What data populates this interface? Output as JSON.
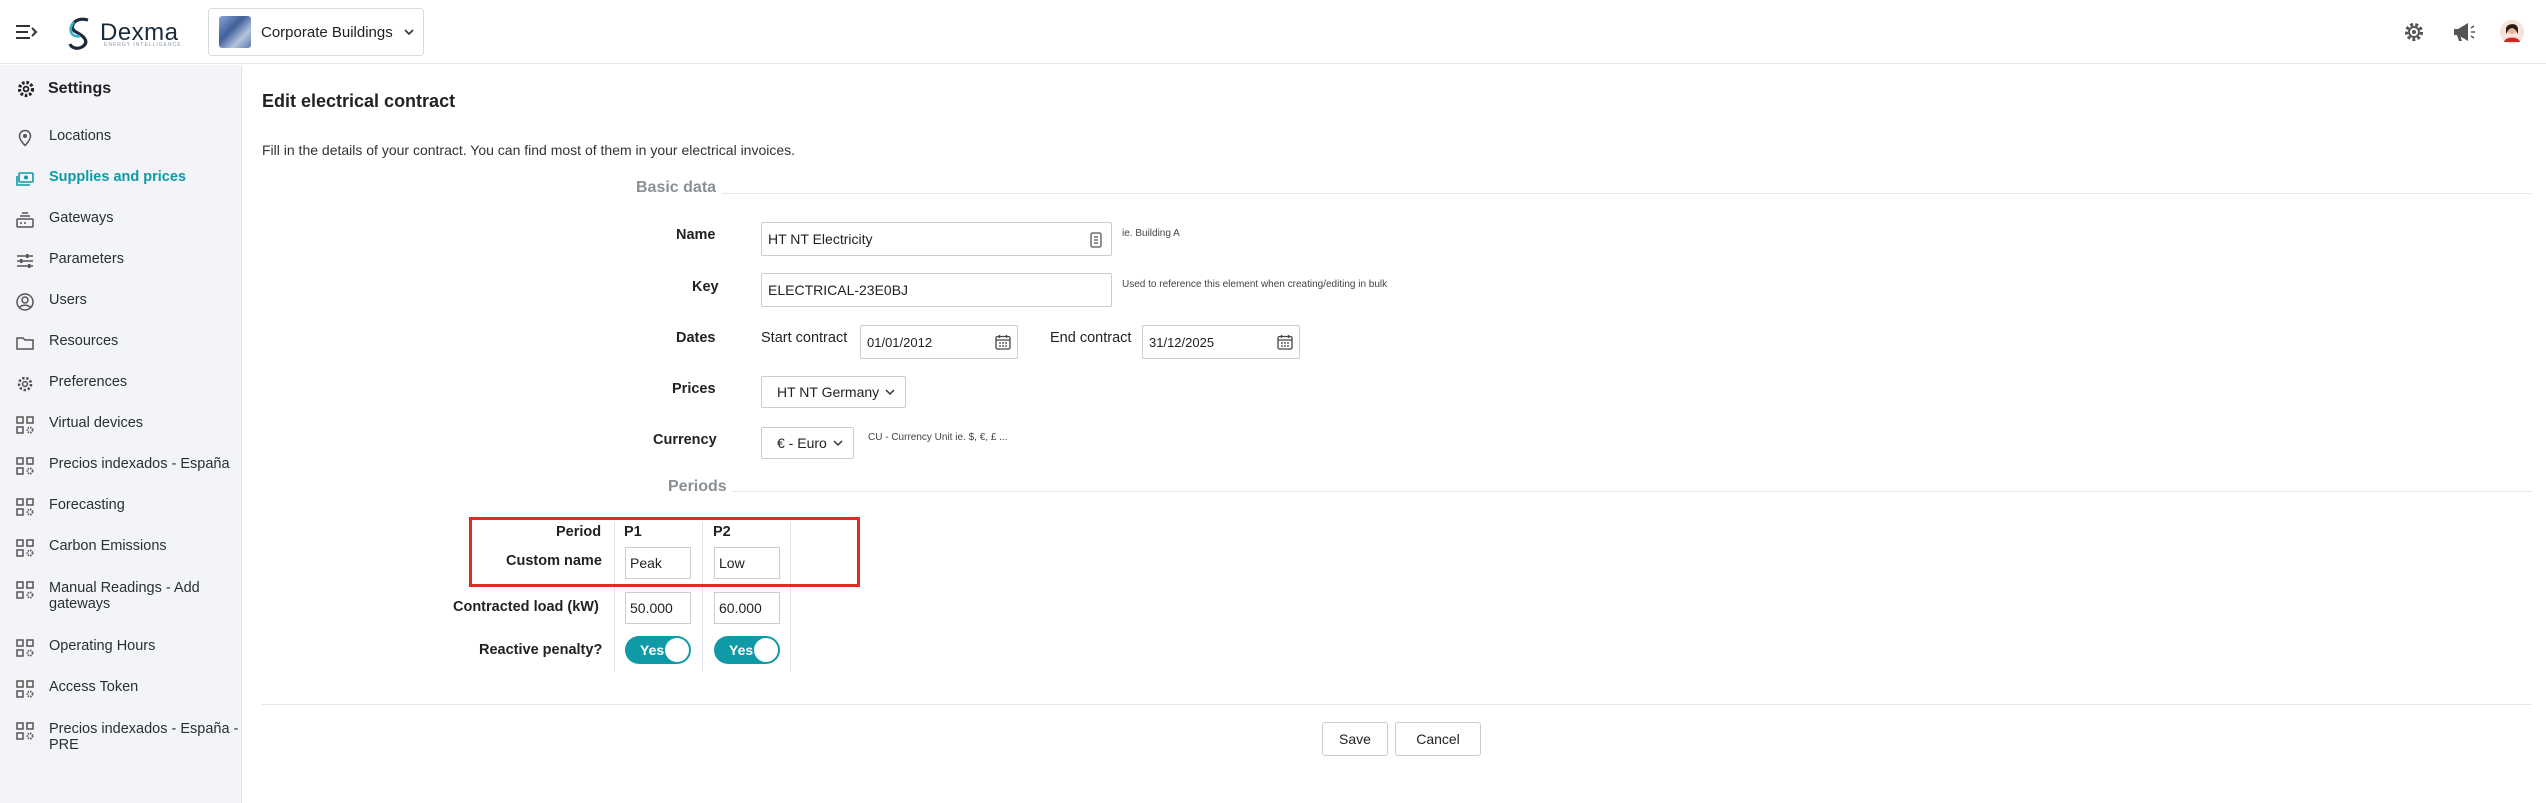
{
  "topbar": {
    "logo_text": "Dexma",
    "logo_sub": "ENERGY INTELLIGENCE",
    "organization": "Corporate Buildings",
    "icons": [
      "gear-icon",
      "megaphone-icon",
      "user-avatar"
    ]
  },
  "sidebar": {
    "title": "Settings",
    "items": [
      {
        "label": "Locations",
        "icon": "map-pin-icon"
      },
      {
        "label": "Supplies and prices",
        "icon": "money-icon",
        "active": true
      },
      {
        "label": "Gateways",
        "icon": "gateway-icon"
      },
      {
        "label": "Parameters",
        "icon": "sliders-icon"
      },
      {
        "label": "Users",
        "icon": "user-circle-icon"
      },
      {
        "label": "Resources",
        "icon": "folder-icon"
      },
      {
        "label": "Preferences",
        "icon": "gear-icon"
      },
      {
        "label": "Virtual devices",
        "icon": "grid-gear-icon"
      },
      {
        "label": "Precios indexados - España",
        "icon": "grid-gear-icon"
      },
      {
        "label": "Forecasting",
        "icon": "grid-gear-icon"
      },
      {
        "label": "Carbon Emissions",
        "icon": "grid-gear-icon"
      },
      {
        "label": "Manual Readings - Add gateways",
        "icon": "grid-gear-icon"
      },
      {
        "label": "Operating Hours",
        "icon": "grid-gear-icon"
      },
      {
        "label": "Access Token",
        "icon": "grid-gear-icon"
      },
      {
        "label": "Precios indexados - España - PRE",
        "icon": "grid-gear-icon"
      }
    ]
  },
  "main": {
    "title": "Edit electrical contract",
    "intro": "Fill in the details of your contract. You can find most of them in your electrical invoices.",
    "basic_data": {
      "heading": "Basic data",
      "name_label": "Name",
      "name_value": "HT NT Electricity",
      "name_hint": "ie. Building A",
      "key_label": "Key",
      "key_value": "ELECTRICAL-23E0BJ",
      "key_hint": "Used to reference this element when creating/editing in bulk",
      "dates_label": "Dates",
      "start_label": "Start contract",
      "start_value": "01/01/2012",
      "end_label": "End contract",
      "end_value": "31/12/2025",
      "prices_label": "Prices",
      "prices_value": "HT NT Germany",
      "currency_label": "Currency",
      "currency_value": "€ - Euro",
      "currency_hint": "CU - Currency Unit ie. $, €, £ ..."
    },
    "periods": {
      "heading": "Periods",
      "period_label": "Period",
      "custom_name_label": "Custom name",
      "contracted_load_label": "Contracted load (kW)",
      "reactive_label": "Reactive penalty?",
      "columns": [
        {
          "period": "P1",
          "custom_name": "Peak",
          "load": "50.000",
          "reactive": "Yes"
        },
        {
          "period": "P2",
          "custom_name": "Low",
          "load": "60.000",
          "reactive": "Yes"
        }
      ]
    },
    "actions": {
      "save": "Save",
      "cancel": "Cancel"
    }
  },
  "colors": {
    "accent": "#0e9aa7",
    "highlight": "#e02b20"
  }
}
